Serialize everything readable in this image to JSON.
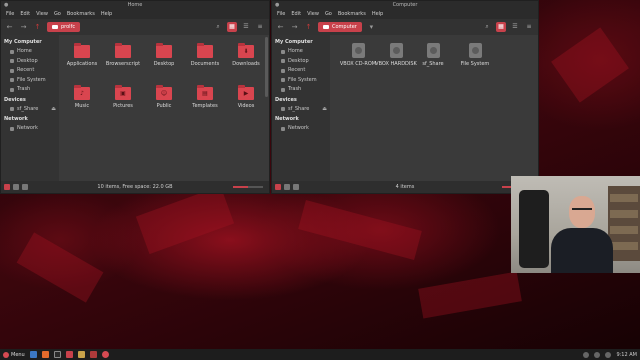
{
  "desktop": {
    "wallpaper": "red abstract polygons",
    "accent_color": "#c8414b"
  },
  "left_window": {
    "title": "Home",
    "menu": [
      "File",
      "Edit",
      "View",
      "Go",
      "Bookmarks",
      "Help"
    ],
    "path_button": "prolfc",
    "sidebar": {
      "my_computer_heading": "My Computer",
      "places": [
        "Home",
        "Desktop",
        "Recent",
        "File System",
        "Trash"
      ],
      "devices_heading": "Devices",
      "devices": [
        "sf_Share"
      ],
      "network_heading": "Network",
      "network": [
        "Network"
      ]
    },
    "items": [
      {
        "name": "Applications",
        "icon": "folder-icon"
      },
      {
        "name": "Browserscript",
        "icon": "folder-icon"
      },
      {
        "name": "Desktop",
        "icon": "folder-icon"
      },
      {
        "name": "Documents",
        "icon": "folder-icon"
      },
      {
        "name": "Downloads",
        "icon": "download-folder-icon"
      },
      {
        "name": "Music",
        "icon": "music-folder-icon"
      },
      {
        "name": "Pictures",
        "icon": "pictures-folder-icon"
      },
      {
        "name": "Public",
        "icon": "public-folder-icon"
      },
      {
        "name": "Templates",
        "icon": "templates-folder-icon"
      },
      {
        "name": "Videos",
        "icon": "video-folder-icon"
      }
    ],
    "status": "10 items, Free space: 22.0 GB"
  },
  "right_window": {
    "title": "Computer",
    "menu": [
      "File",
      "Edit",
      "View",
      "Go",
      "Bookmarks",
      "Help"
    ],
    "path_button": "Computer",
    "sidebar": {
      "my_computer_heading": "My Computer",
      "places": [
        "Home",
        "Desktop",
        "Recent",
        "File System",
        "Trash"
      ],
      "devices_heading": "Devices",
      "devices": [
        "sf_Share"
      ],
      "network_heading": "Network",
      "network": [
        "Network"
      ]
    },
    "items": [
      {
        "name": "VBOX CD-ROM",
        "icon": "optical-drive-icon"
      },
      {
        "name": "VBOX HARDDISK",
        "icon": "hard-disk-icon"
      },
      {
        "name": "sf_Share",
        "icon": "share-drive-icon"
      },
      {
        "name": "File System",
        "icon": "filesystem-drive-icon"
      }
    ],
    "status": "4 items"
  },
  "taskbar": {
    "menu_label": "Menu",
    "clock": "9:12 AM"
  }
}
